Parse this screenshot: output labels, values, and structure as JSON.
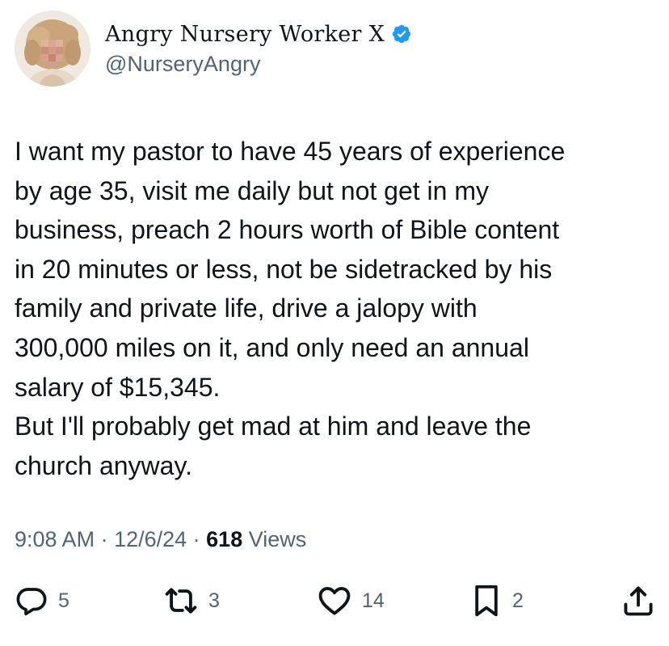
{
  "author": {
    "display_name": "Angry Nursery Worker X",
    "handle": "@NurseryAngry",
    "verified": true
  },
  "tweet": {
    "text": "I want my pastor to have 45 years of experience\nby age 35, visit me daily but not get in my\nbusiness, preach 2 hours worth of Bible content\nin 20 minutes or less, not be sidetracked by his\nfamily and private life, drive a jalopy with\n300,000 miles on it, and only need an annual\nsalary of $15,345.\nBut I'll probably get mad at him and leave the\nchurch anyway."
  },
  "meta": {
    "time": "9:08 AM",
    "separator": " · ",
    "date": "12/6/24",
    "views_count": "618",
    "views_label": " Views"
  },
  "actions": {
    "replies": "5",
    "reposts": "3",
    "likes": "14",
    "bookmarks": "2"
  },
  "colors": {
    "text": "#0f1419",
    "secondary": "#536471",
    "verified": "#1d9bf0"
  },
  "icons": {
    "avatar": "avatar-image",
    "verified": "verified-badge-icon",
    "reply": "reply-icon",
    "repost": "repost-icon",
    "like": "heart-icon",
    "bookmark": "bookmark-icon",
    "share": "share-icon"
  }
}
